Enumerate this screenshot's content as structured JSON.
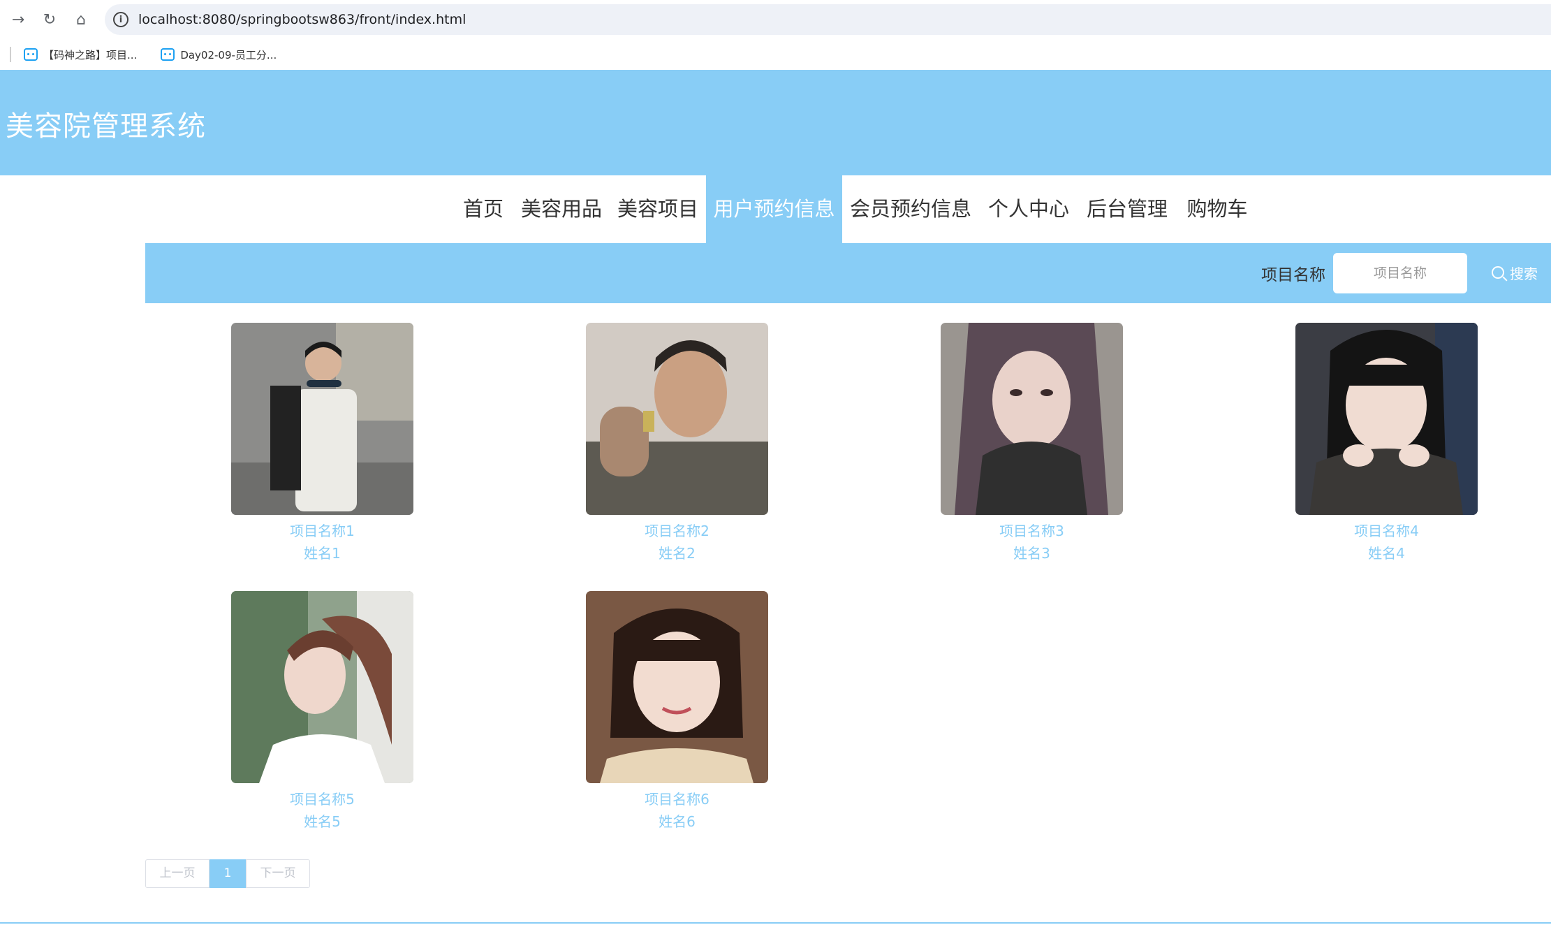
{
  "browser": {
    "url": "localhost:8080/springbootsw863/front/index.html",
    "bookmarks": [
      {
        "label": "【码神之路】项目..."
      },
      {
        "label": "Day02-09-员工分..."
      }
    ]
  },
  "site": {
    "title": "美容院管理系统"
  },
  "menu": {
    "items": [
      {
        "label": "首页"
      },
      {
        "label": "美容用品"
      },
      {
        "label": "美容项目"
      },
      {
        "label": "用户预约信息"
      },
      {
        "label": "会员预约信息"
      },
      {
        "label": "个人中心"
      },
      {
        "label": "后台管理"
      },
      {
        "label": "购物车"
      }
    ],
    "active_index": 3
  },
  "search": {
    "label": "项目名称",
    "placeholder": "项目名称",
    "button_label": "搜索"
  },
  "cards": [
    {
      "title": "项目名称1",
      "name": "姓名1"
    },
    {
      "title": "项目名称2",
      "name": "姓名2"
    },
    {
      "title": "项目名称3",
      "name": "姓名3"
    },
    {
      "title": "项目名称4",
      "name": "姓名4"
    },
    {
      "title": "项目名称5",
      "name": "姓名5"
    },
    {
      "title": "项目名称6",
      "name": "姓名6"
    }
  ],
  "pagination": {
    "prev_label": "上一页",
    "current_page": "1",
    "next_label": "下一页"
  },
  "colors": {
    "accent": "#88cdf6",
    "text": "#333333"
  }
}
